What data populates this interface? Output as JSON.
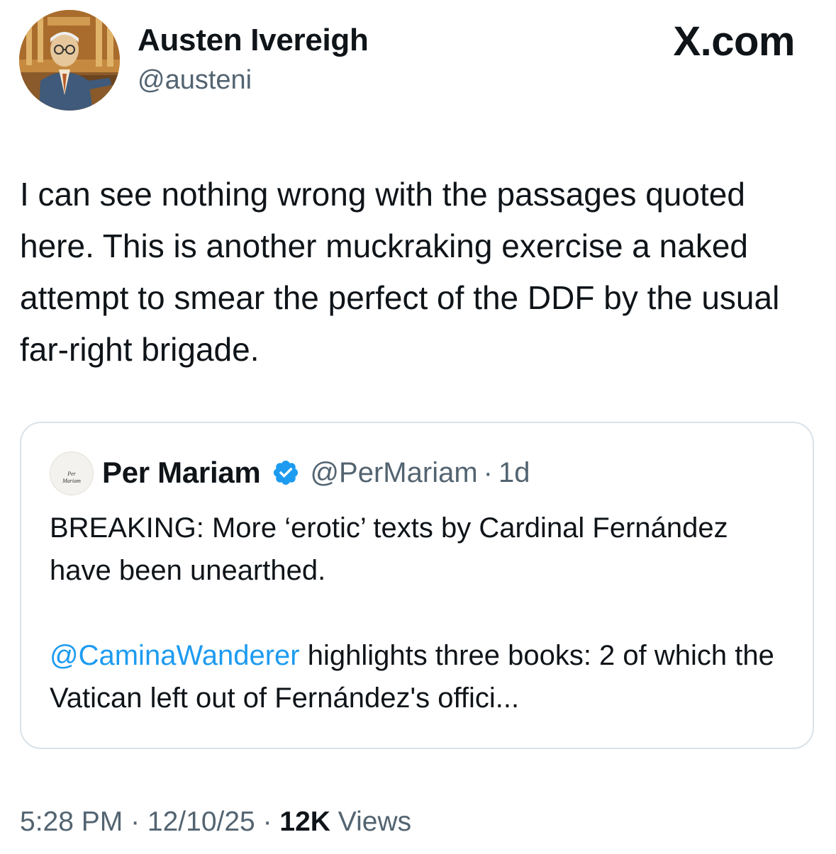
{
  "author": {
    "name": "Austen Ivereigh",
    "handle": "@austeni",
    "avatar_icon": "profile-photo"
  },
  "brand": {
    "site": "X.com"
  },
  "tweet": {
    "text": "I can see nothing wrong with the passages quoted here. This is another muckraking exercise a naked attempt to smear the perfect of the DDF by the usual far-right brigade."
  },
  "quoted_tweet": {
    "name": "Per Mariam",
    "verified_icon": "verified-badge-icon",
    "handle": "@PerMariam",
    "separator": "·",
    "age": "1d",
    "avatar_logo_text_1": "Per",
    "avatar_logo_text_2": "Mariam",
    "paragraph_1": "BREAKING: More ‘erotic’ texts by Cardinal Fernández have been unearthed.",
    "mention": "@CaminaWanderer",
    "paragraph_2_rest": " highlights three books: 2 of which the Vatican left out of Fernández's offici..."
  },
  "meta": {
    "time": "5:28 PM",
    "sep1": " · ",
    "date": "12/10/25",
    "sep2": " · ",
    "views_count": "12K",
    "views_label": " Views"
  },
  "colors": {
    "text": "#0f1419",
    "secondary": "#536471",
    "link": "#1d9bf0",
    "border": "#d9e2e8"
  }
}
